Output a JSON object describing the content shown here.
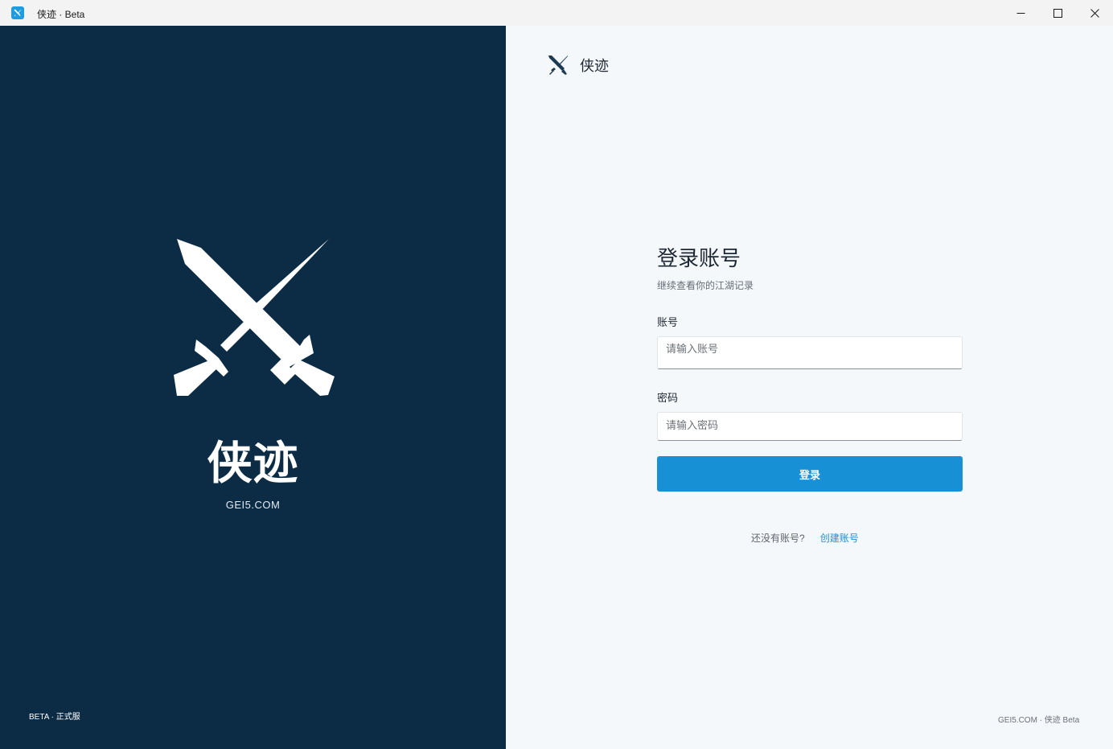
{
  "window": {
    "title": "侠迹 · Beta",
    "icon": "crossed-swords-icon",
    "controls": [
      "minimize-icon",
      "maximize-icon",
      "close-icon"
    ]
  },
  "hero": {
    "icon": "crossed-swords-icon",
    "title": "侠迹",
    "domain": "GEI5.COM",
    "footer": "BETA · 正式服"
  },
  "brand": {
    "icon": "crossed-swords-icon",
    "name": "侠迹"
  },
  "login": {
    "title": "登录账号",
    "subtitle": "继续查看你的江湖记录",
    "account_label": "账号",
    "account_placeholder": "请输入账号",
    "account_value": "",
    "password_label": "密码",
    "password_placeholder": "请输入密码",
    "password_value": "",
    "submit_label": "登录",
    "signup_prompt": "还没有账号?",
    "signup_link": "创建账号"
  },
  "footer": {
    "right": "GEI5.COM · 侠迹 Beta"
  },
  "colors": {
    "left_panel_bg": "#0c2c45",
    "right_panel_bg": "#f5f8fb",
    "accent": "#1890d5",
    "titlebar_bg": "#f3f3f3"
  }
}
